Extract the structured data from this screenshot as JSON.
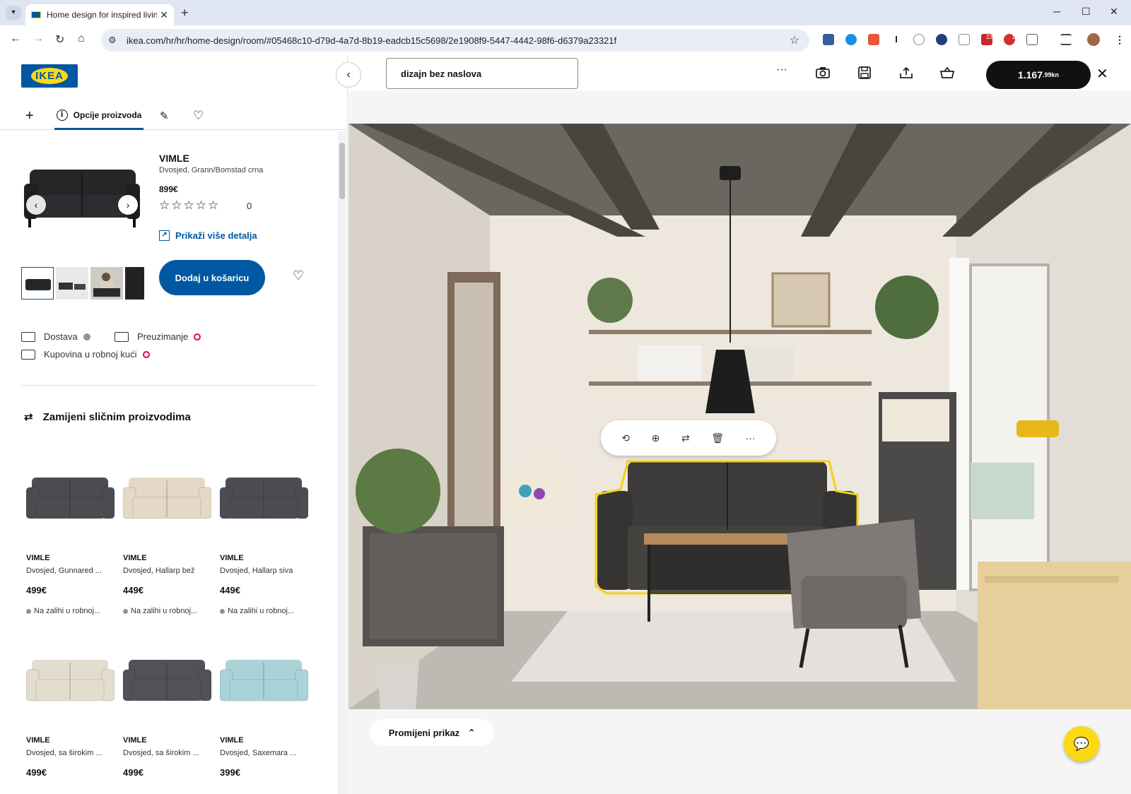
{
  "browser": {
    "tab_title": "Home design for inspired living",
    "tab_close": "✕",
    "new_tab": "+",
    "url": "ikea.com/hr/hr/home-design/room/#05468c10-d79d-4a7d-8b19-eadcb15c5698/2e1908f9-5447-4442-98f6-d6379a23321f",
    "ext_badges": [
      "23",
      "1"
    ]
  },
  "logo": "IKEA",
  "left_tabs": {
    "add": "+",
    "options": "Opcije proizvoda",
    "info_glyph": "i"
  },
  "product": {
    "name": "VIMLE",
    "description": "Dvosjed, Grann/Bomstad crna",
    "price": "899€",
    "stars": "☆☆☆☆☆",
    "rating_count": "0",
    "details_link": "Prikaži više detalja",
    "add_to_cart": "Dodaj u košaricu",
    "prev": "‹",
    "next": "›"
  },
  "availability": {
    "delivery": "Dostava",
    "pickup": "Preuzimanje",
    "store": "Kupovina u robnoj kući"
  },
  "swap": {
    "heading": "Zamijeni sličnim proizvodima",
    "items": [
      {
        "name": "VIMLE",
        "desc": "Dvosjed, Gunnared ...",
        "price": "499€",
        "stock": "Na zalihi u robnoj...",
        "color": "#4a4c50"
      },
      {
        "name": "VIMLE",
        "desc": "Dvosjed, Hallarp bež",
        "price": "449€",
        "stock": "Na zalihi u robnoj...",
        "color": "#e6d8c6"
      },
      {
        "name": "VIMLE",
        "desc": "Dvosjed, Hallarp siva",
        "price": "449€",
        "stock": "Na zalihi u robnoj...",
        "color": "#4b4d52"
      },
      {
        "name": "VIMLE",
        "desc": "Dvosjed, sa širokim ...",
        "price": "499€",
        "color": "#e3ddcf"
      },
      {
        "name": "VIMLE",
        "desc": "Dvosjed, sa širokim ...",
        "price": "499€",
        "color": "#505258"
      },
      {
        "name": "VIMLE",
        "desc": "Dvosjed, Saxemara ...",
        "price": "399€",
        "color": "#a9d3d8"
      }
    ]
  },
  "designer": {
    "design_name": "dizajn bez naslova",
    "more": "···",
    "total_main": "1.167",
    "total_cents": ".99",
    "total_unit": " kn",
    "close": "✕",
    "change_view": "Promijeni prikaz",
    "collapse": "‹"
  },
  "colors": {
    "brand_blue": "#0058a3",
    "brand_yellow": "#fbd914",
    "selection": "#f0d21a"
  }
}
